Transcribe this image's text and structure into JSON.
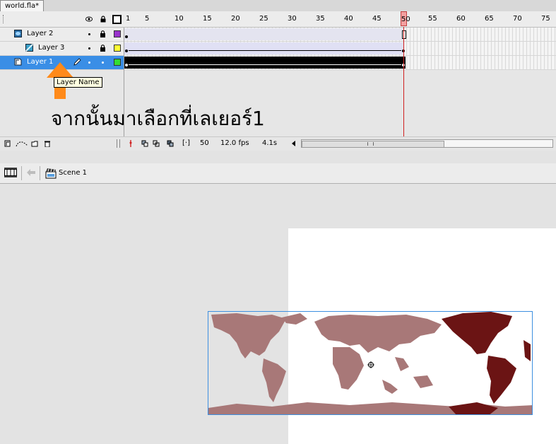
{
  "document": {
    "tab_title": "world.fla*"
  },
  "timeline": {
    "ruler_ticks": [
      "1",
      "5",
      "10",
      "15",
      "20",
      "25",
      "30",
      "35",
      "40",
      "45",
      "50",
      "55",
      "60",
      "65",
      "70",
      "75"
    ],
    "playhead_frame": "50",
    "layers": [
      {
        "name": "Layer 2",
        "color": "#9933cc",
        "type": "mask"
      },
      {
        "name": "Layer 3",
        "color": "#ffff33",
        "type": "masked"
      },
      {
        "name": "Layer 1",
        "color": "#33dd33",
        "type": "normal",
        "selected": true
      }
    ],
    "status": {
      "current_frame": "50",
      "fps": "12.0 fps",
      "elapsed": "4.1s"
    }
  },
  "tooltip": {
    "text": "Layer Name"
  },
  "caption": {
    "text": "จากนั้นมาเลือกที่เลเยอร์1"
  },
  "scene_bar": {
    "scene_name": "Scene 1"
  },
  "colors": {
    "selection": "#3a8ee6",
    "playhead": "#d02020",
    "map_land": "#b08888",
    "map_dark": "#6b1414",
    "arrow": "#ff8a1a"
  }
}
